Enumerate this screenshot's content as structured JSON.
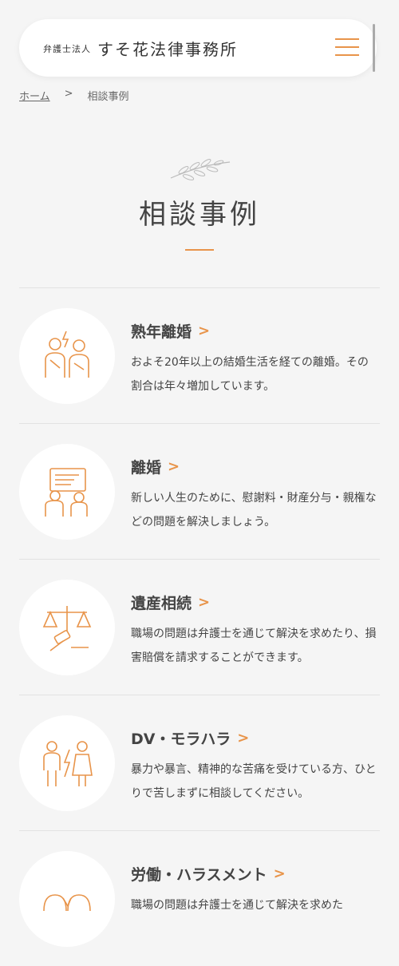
{
  "header": {
    "logo_sub": "弁護士法人",
    "logo_main": "すそ花法律事務所"
  },
  "breadcrumb": {
    "home": "ホーム",
    "separator": ">",
    "current": "相談事例"
  },
  "page": {
    "title": "相談事例"
  },
  "colors": {
    "accent": "#e8944a",
    "background": "#f5f5f5"
  },
  "cases": [
    {
      "title": "熟年離婚",
      "desc": "およそ20年以上の結婚生活を経ての離婚。その割合は年々増加しています。",
      "icon": "couple-conflict-icon"
    },
    {
      "title": "離婚",
      "desc": "新しい人生のために、慰謝料・財産分与・親権などの問題を解決しましょう。",
      "icon": "divorce-paper-icon"
    },
    {
      "title": "遺産相続",
      "desc": "職場の問題は弁護士を通じて解決を求めたり、損害賠償を請求することができます。",
      "icon": "scale-gavel-icon"
    },
    {
      "title": "DV・モラハラ",
      "desc": "暴力や暴言、精神的な苦痛を受けている方、ひとりで苦しまずに相談してください。",
      "icon": "dv-couple-icon"
    },
    {
      "title": "労働・ハラスメント",
      "desc": "職場の問題は弁護士を通じて解決を求めた",
      "icon": "workplace-icon"
    }
  ]
}
